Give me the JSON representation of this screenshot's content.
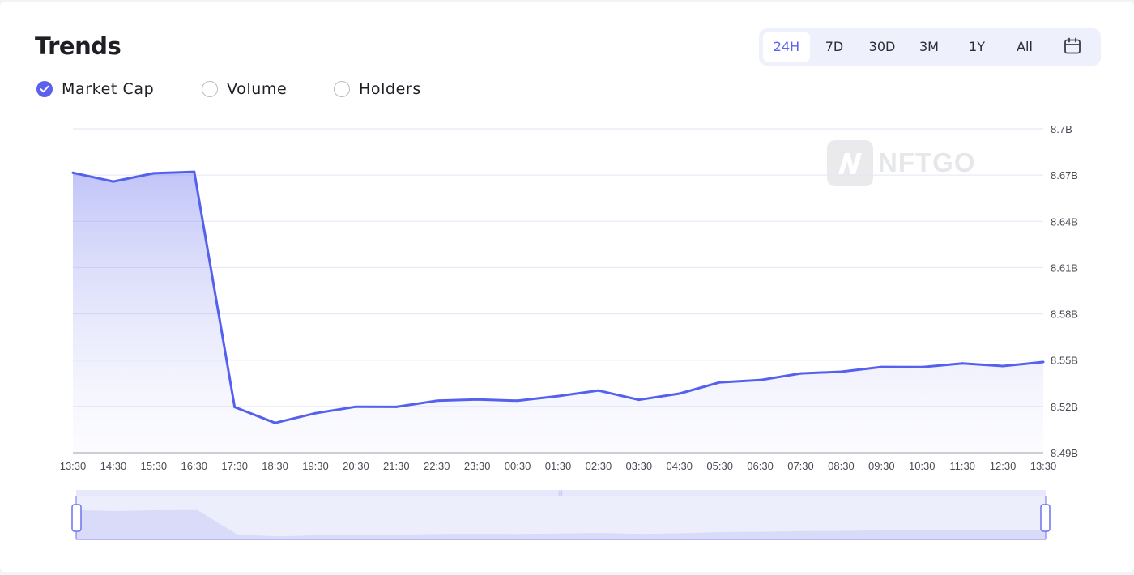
{
  "title": "Trends",
  "ranges": [
    "24H",
    "7D",
    "30D",
    "3M",
    "1Y",
    "All"
  ],
  "active_range": "24H",
  "metrics": [
    {
      "label": "Market Cap",
      "checked": true
    },
    {
      "label": "Volume",
      "checked": false
    },
    {
      "label": "Holders",
      "checked": false
    }
  ],
  "watermark": "NFTGO",
  "colors": {
    "accent": "#5a64f0",
    "line": "#5561ee",
    "grid": "#e3e5f3"
  },
  "chart_data": {
    "type": "area",
    "title": "",
    "xlabel": "",
    "ylabel": "",
    "x": [
      "13:30",
      "14:30",
      "15:30",
      "16:30",
      "17:30",
      "18:30",
      "19:30",
      "20:30",
      "21:30",
      "22:30",
      "23:30",
      "00:30",
      "01:30",
      "02:30",
      "03:30",
      "04:30",
      "05:30",
      "06:30",
      "07:30",
      "08:30",
      "09:30",
      "10:30",
      "11:30",
      "12:30",
      "13:30"
    ],
    "series": [
      {
        "name": "Market Cap",
        "values": [
          8.6715,
          8.6658,
          8.6712,
          8.6721,
          8.5196,
          8.5093,
          8.5156,
          8.5198,
          8.5197,
          8.5237,
          8.5245,
          8.5237,
          8.5267,
          8.5303,
          8.5243,
          8.5283,
          8.5356,
          8.5371,
          8.5414,
          8.5425,
          8.5456,
          8.5455,
          8.5479,
          8.5462,
          8.5488
        ]
      }
    ],
    "ylim": [
      8.49,
      8.7
    ],
    "yticks": [
      "8.7B",
      "8.67B",
      "8.64B",
      "8.61B",
      "8.58B",
      "8.55B",
      "8.52B",
      "8.49B"
    ],
    "ytick_values": [
      8.7,
      8.67,
      8.64,
      8.61,
      8.58,
      8.55,
      8.52,
      8.49
    ],
    "grid": true,
    "y_axis_position": "right",
    "legend": "none"
  }
}
